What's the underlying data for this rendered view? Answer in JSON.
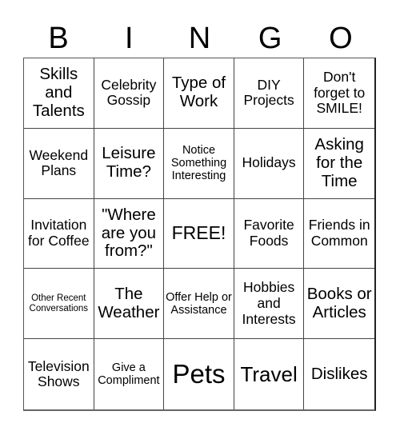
{
  "card": {
    "header": [
      "B",
      "I",
      "N",
      "G",
      "O"
    ],
    "cells": [
      [
        "Skills and Talents",
        "Celebrity Gossip",
        "Type of Work",
        "DIY Projects",
        "Don't forget to SMILE!"
      ],
      [
        "Weekend Plans",
        "Leisure Time?",
        "Notice Something Interesting",
        "Holidays",
        "Asking for the Time"
      ],
      [
        "Invitation for Coffee",
        "\"Where are you from?\"",
        "FREE!",
        "Favorite Foods",
        "Friends in Common"
      ],
      [
        "Other Recent Conversations",
        "The Weather",
        "Offer Help or Assistance",
        "Hobbies and Interests",
        "Books or Articles"
      ],
      [
        "Television Shows",
        "Give a Compliment",
        "Pets",
        "Travel",
        "Dislikes"
      ]
    ],
    "free_space": "FREE!"
  }
}
